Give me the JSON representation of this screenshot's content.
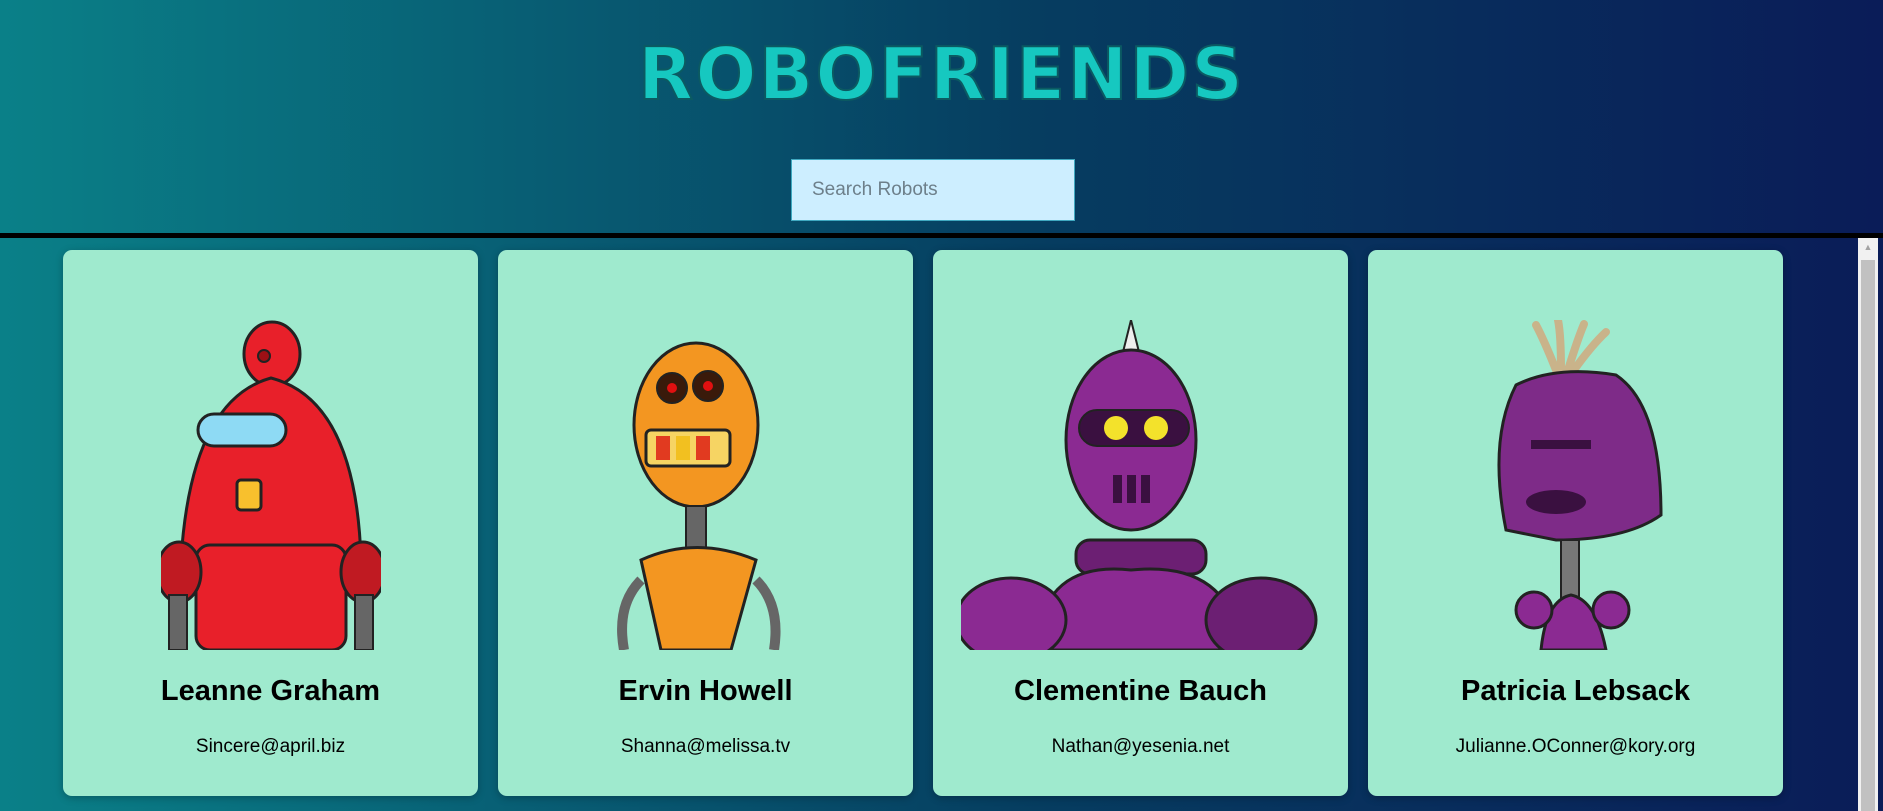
{
  "header": {
    "title": "ROBOFRIENDS"
  },
  "search": {
    "placeholder": "Search Robots",
    "value": ""
  },
  "robots": [
    {
      "name": "Leanne Graham",
      "email": "Sincere@april.biz",
      "color": "#e8202a"
    },
    {
      "name": "Ervin Howell",
      "email": "Shanna@melissa.tv",
      "color": "#f39621"
    },
    {
      "name": "Clementine Bauch",
      "email": "Nathan@yesenia.net",
      "color": "#8b2a92"
    },
    {
      "name": "Patricia Lebsack",
      "email": "Julianne.OConner@kory.org",
      "color": "#7e2b88"
    }
  ],
  "colors": {
    "card_bg": "#9feace",
    "title": "#16c8c0",
    "search_bg": "#cdeeff"
  },
  "icons": {
    "scroll_up": "triangle-up-icon"
  }
}
